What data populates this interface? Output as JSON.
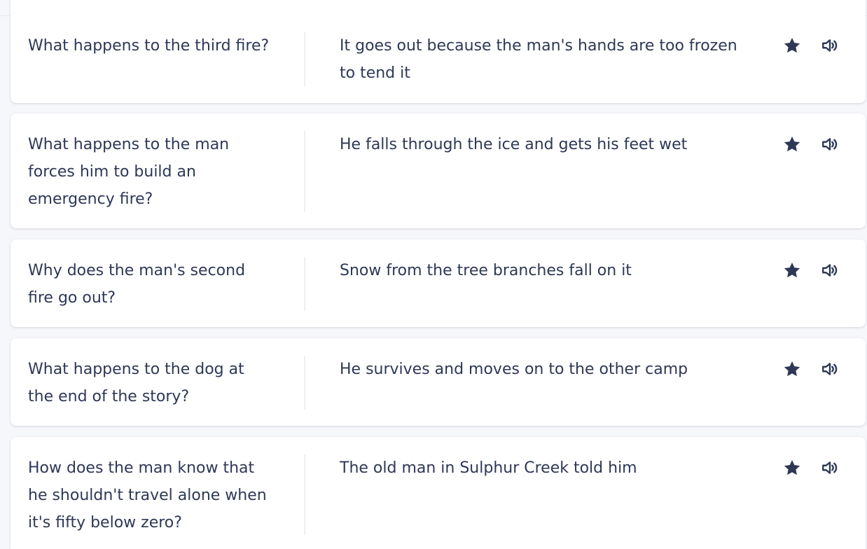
{
  "icons": {
    "star": "star-icon",
    "audio": "speaker-icon"
  },
  "colors": {
    "page_background": "#f6f7fb",
    "card_background": "#ffffff",
    "text": "#2e3856",
    "icon": "#2e3856",
    "divider": "#edeff4"
  },
  "cards": [
    {
      "term": "What happens to the third fire?",
      "definition": "It goes out because the man's hands are too frozen to tend it"
    },
    {
      "term": "What happens to the man forces him to build an emergency fire?",
      "definition": "He falls through the ice and gets his feet wet"
    },
    {
      "term": "Why does the man's second fire go out?",
      "definition": "Snow from the tree branches fall on it"
    },
    {
      "term": "What happens to the dog at the end of the story?",
      "definition": "He survives and moves on to the other camp"
    },
    {
      "term": "How does the man know that he shouldn't travel alone when it's fifty below zero?",
      "definition": "The old man in Sulphur Creek told him"
    }
  ]
}
